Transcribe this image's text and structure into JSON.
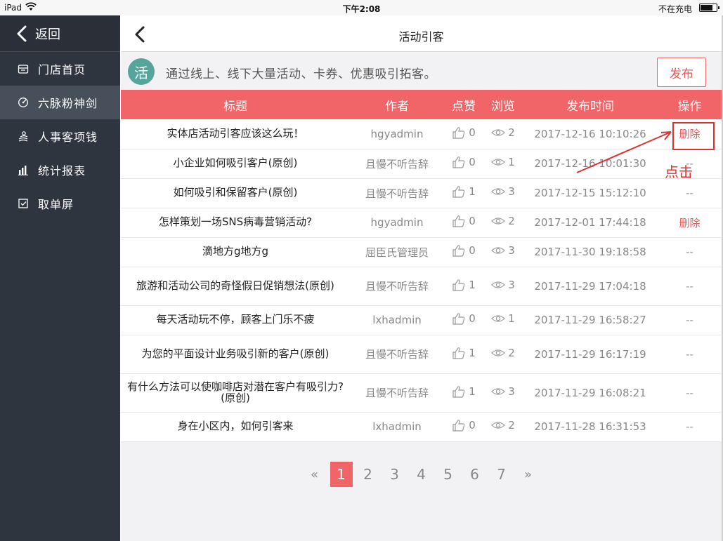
{
  "statusbar": {
    "carrier": "iPad",
    "time": "下午2:08",
    "charge": "不在充电"
  },
  "sidebar": {
    "back_label": "返回",
    "items": [
      {
        "label": "门店首页",
        "icon": "store-icon"
      },
      {
        "label": "六脉粉神剑",
        "icon": "target-icon"
      },
      {
        "label": "人事客项钱",
        "icon": "people-icon"
      },
      {
        "label": "统计报表",
        "icon": "bar-chart-icon"
      },
      {
        "label": "取单屏",
        "icon": "checkbox-icon"
      }
    ]
  },
  "header": {
    "title": "活动引客"
  },
  "banner": {
    "badge": "活",
    "text": "通过线上、线下大量活动、卡券、优惠吸引拓客。",
    "publish_label": "发布"
  },
  "table": {
    "headers": {
      "title": "标题",
      "author": "作者",
      "likes": "点赞",
      "views": "浏览",
      "time": "发布时间",
      "op": "操作"
    },
    "rows": [
      {
        "title": "实体店活动引客应该这么玩！",
        "author": "hgyadmin",
        "likes": "0",
        "views": "2",
        "time": "2017-12-16 10:10:26",
        "op": "删除"
      },
      {
        "title": "小企业如何吸引客户(原创)",
        "author": "且慢不听告辞",
        "likes": "0",
        "views": "1",
        "time": "2017-12-16 10:01:30",
        "op": "--"
      },
      {
        "title": "如何吸引和保留客户(原创)",
        "author": "且慢不听告辞",
        "likes": "1",
        "views": "3",
        "time": "2017-12-15 15:12:10",
        "op": "--"
      },
      {
        "title": "怎样策划一场SNS病毒营销活动?",
        "author": "hgyadmin",
        "likes": "0",
        "views": "2",
        "time": "2017-12-01 17:44:18",
        "op": "删除"
      },
      {
        "title": "滴地方g地方g",
        "author": "屈臣氏管理员",
        "likes": "0",
        "views": "3",
        "time": "2017-11-30 19:18:58",
        "op": "--"
      },
      {
        "title": "旅游和活动公司的奇怪假日促销想法(原创)",
        "author": "且慢不听告辞",
        "likes": "1",
        "views": "3",
        "time": "2017-11-29 17:04:18",
        "op": "--"
      },
      {
        "title": "每天活动玩不停，顾客上门乐不疲",
        "author": "lxhadmin",
        "likes": "0",
        "views": "1",
        "time": "2017-11-29 16:58:27",
        "op": "--"
      },
      {
        "title": "为您的平面设计业务吸引新的客户(原创)",
        "author": "且慢不听告辞",
        "likes": "1",
        "views": "2",
        "time": "2017-11-29 16:17:19",
        "op": "--"
      },
      {
        "title": "有什么方法可以使咖啡店对潜在客户有吸引力?(原创)",
        "author": "且慢不听告辞",
        "likes": "1",
        "views": "3",
        "time": "2017-11-29 16:08:21",
        "op": "--"
      },
      {
        "title": "身在小区内，如何引客来",
        "author": "lxhadmin",
        "likes": "0",
        "views": "2",
        "time": "2017-11-28 16:31:53",
        "op": "--"
      }
    ]
  },
  "pager": {
    "prev": "«",
    "next": "»",
    "pages": [
      "1",
      "2",
      "3",
      "4",
      "5",
      "6",
      "7"
    ],
    "current": "1"
  },
  "annotation": {
    "text": "点击"
  },
  "colors": {
    "accent": "#f16467",
    "sidebar": "#2f353f",
    "badge": "#56a59a"
  }
}
